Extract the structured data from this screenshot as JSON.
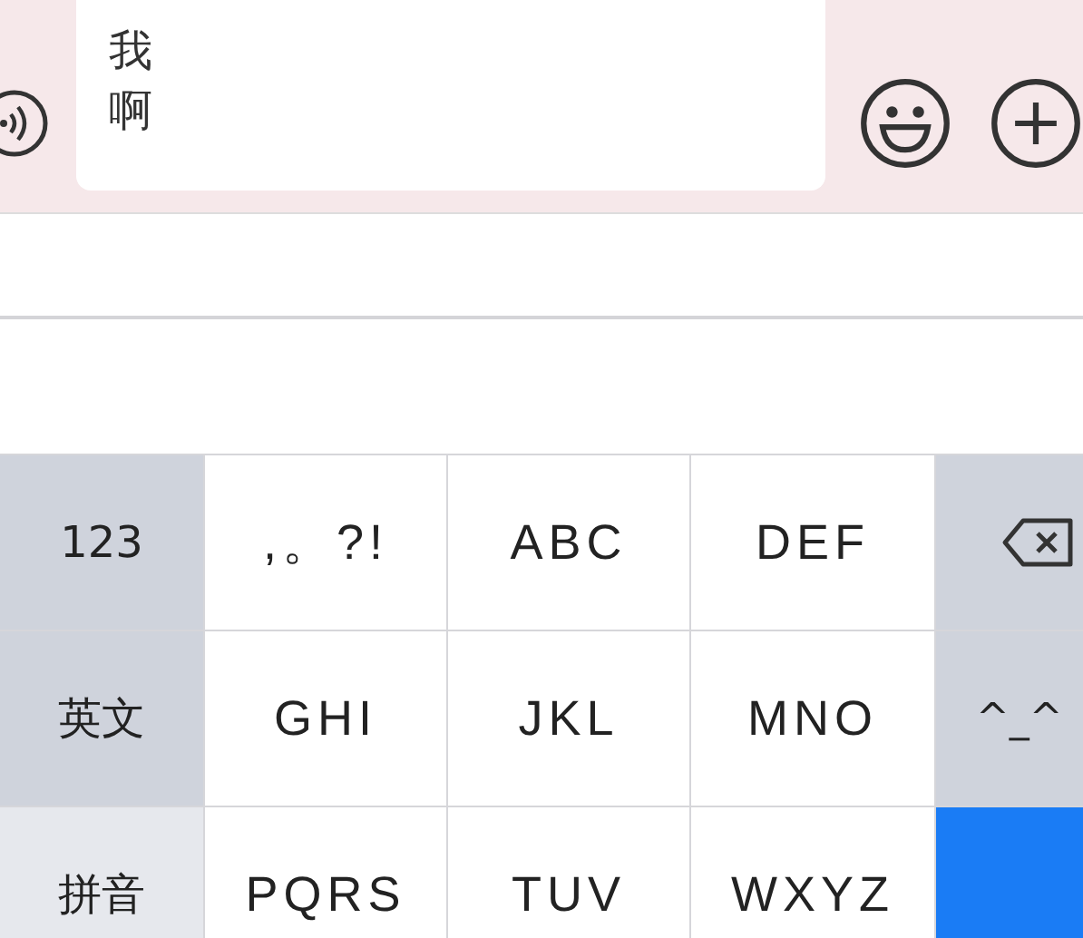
{
  "input_bar": {
    "text": "我啊"
  },
  "keyboard": {
    "rows": [
      [
        {
          "kind": "function",
          "label": "123",
          "selected": false
        },
        {
          "kind": "letter",
          "label": ",。?!"
        },
        {
          "kind": "letter",
          "label": "ABC"
        },
        {
          "kind": "letter",
          "label": "DEF"
        },
        {
          "kind": "delete"
        }
      ],
      [
        {
          "kind": "function",
          "label": "英文",
          "selected": false
        },
        {
          "kind": "letter",
          "label": "GHI"
        },
        {
          "kind": "letter",
          "label": "JKL"
        },
        {
          "kind": "letter",
          "label": "MNO"
        },
        {
          "kind": "function",
          "label": "^_^",
          "selected": false
        }
      ],
      [
        {
          "kind": "function",
          "label": "拼音",
          "selected": true
        },
        {
          "kind": "letter",
          "label": "PQRS"
        },
        {
          "kind": "letter",
          "label": "TUV"
        },
        {
          "kind": "letter",
          "label": "WXYZ"
        },
        {
          "kind": "return"
        }
      ]
    ]
  }
}
